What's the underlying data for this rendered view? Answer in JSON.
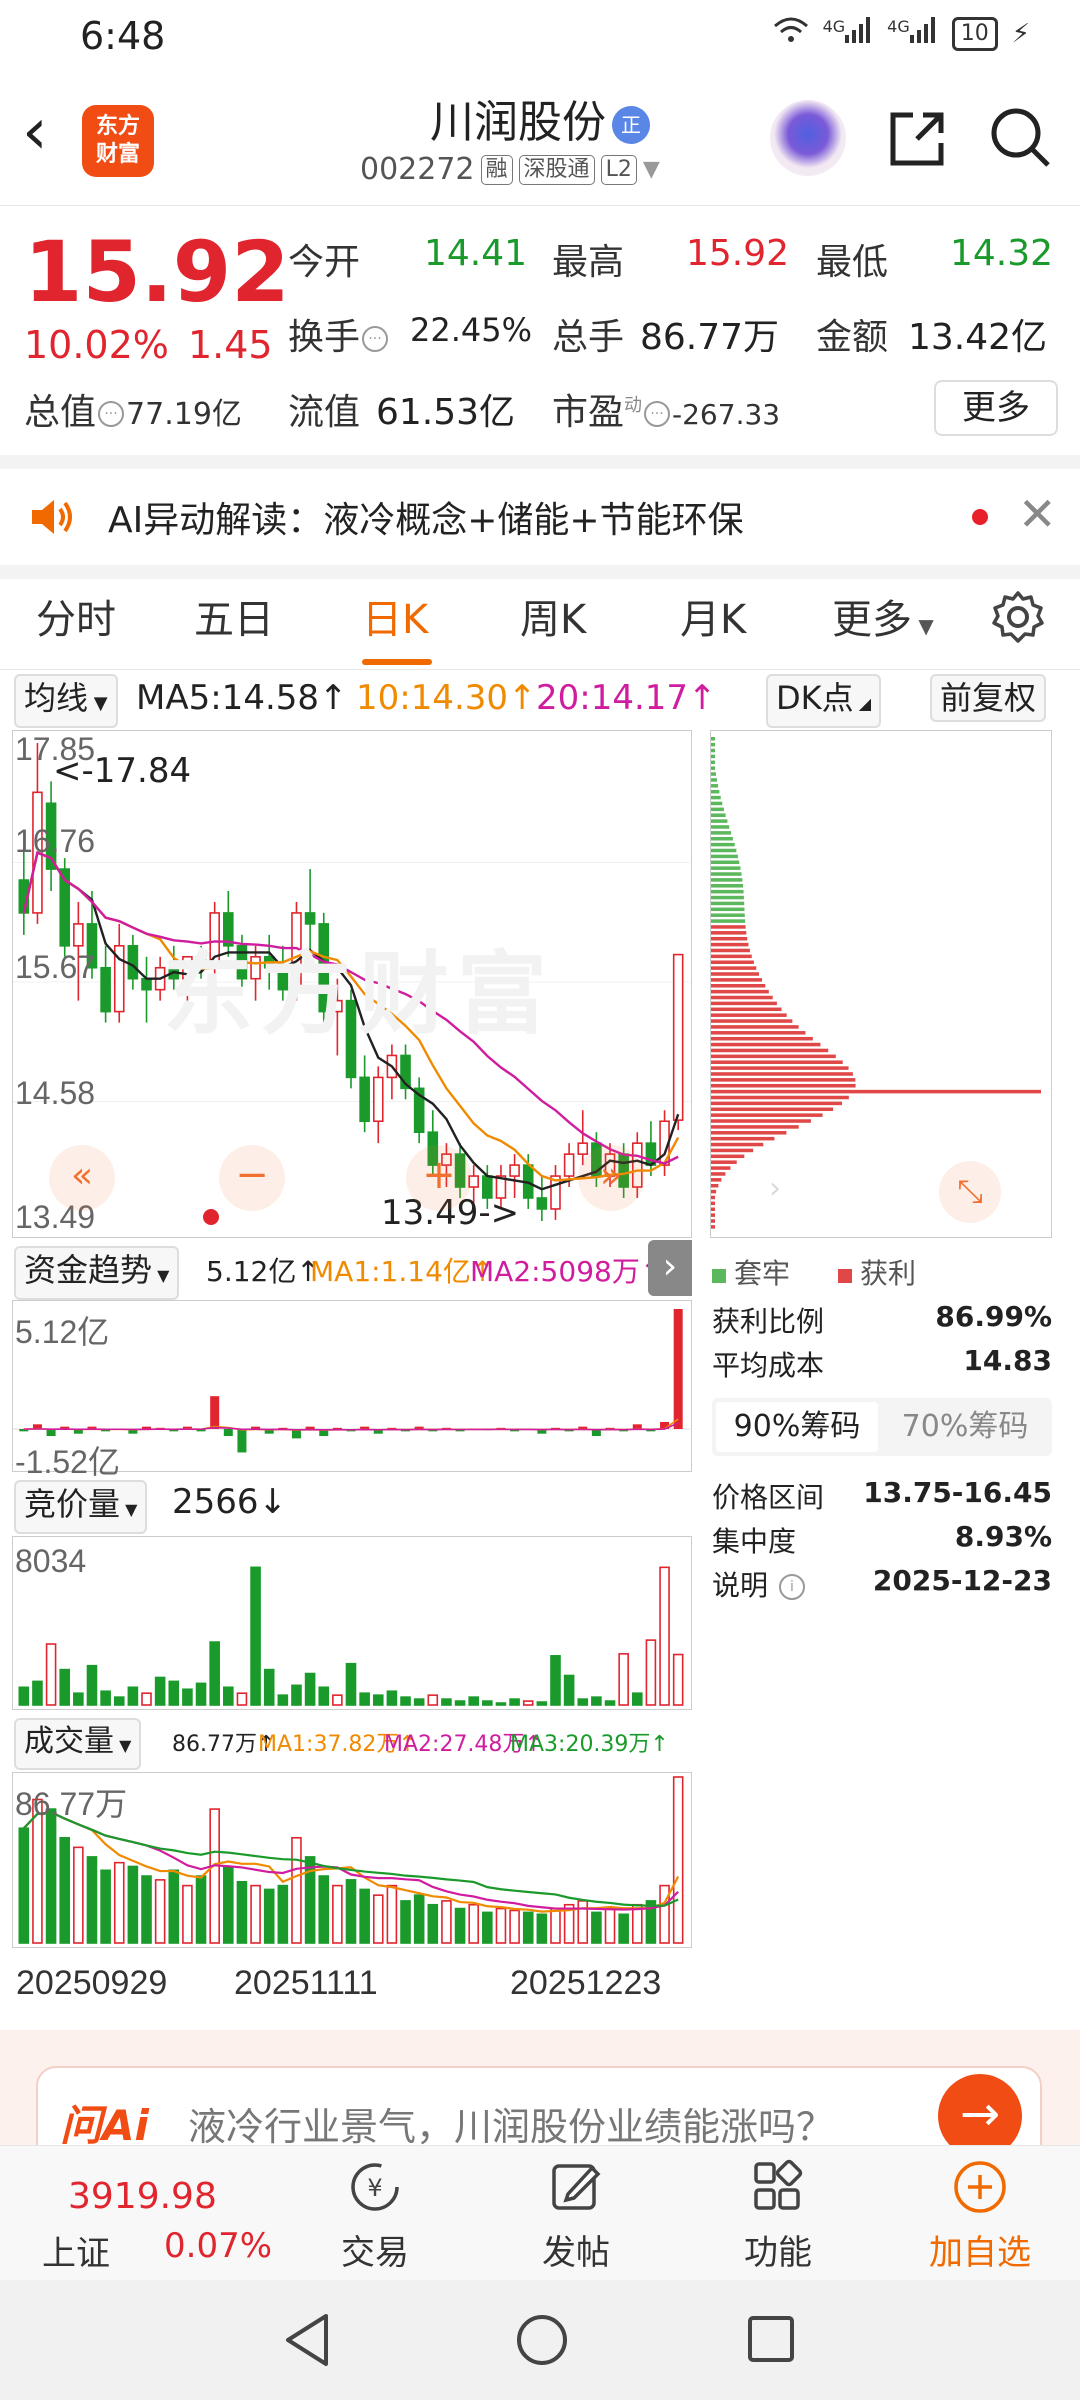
{
  "status": {
    "time": "6:48",
    "net1": "4G",
    "net2": "4G",
    "battery": "10"
  },
  "header": {
    "stock_name": "川润股份",
    "badge": "正",
    "code": "002272",
    "tags": [
      "融",
      "深股通",
      "L2"
    ],
    "logo_line1": "东方",
    "logo_line2": "财富"
  },
  "quote": {
    "price": "15.92",
    "change_pct": "10.02%",
    "change_abs": "1.45",
    "open_label": "今开",
    "open": "14.41",
    "high_label": "最高",
    "high": "15.92",
    "low_label": "最低",
    "low": "14.32",
    "turnover_label": "换手",
    "turnover": "22.45%",
    "volume_label": "总手",
    "volume": "86.77万",
    "amount_label": "金额",
    "amount": "13.42亿",
    "mcap_label": "总值",
    "mcap": "77.19亿",
    "float_label": "流值",
    "float_cap": "61.53亿",
    "pe_label": "市盈",
    "pe_sup": "动",
    "pe": "-267.33",
    "more_label": "更多"
  },
  "ai_bar": {
    "text": "AI异动解读：液冷概念+储能+节能环保"
  },
  "tabs": [
    "分时",
    "五日",
    "日K",
    "周K",
    "月K",
    "更多"
  ],
  "active_tab": 2,
  "ma_row": {
    "selector": "均线",
    "ma5": "MA5:14.58↑",
    "ma10": "10:14.30↑",
    "ma20": "20:14.17↑",
    "dk": "DK点",
    "adjust": "前复权"
  },
  "kline": {
    "y_labels": [
      "17.85",
      "16.76",
      "15.67",
      "14.58",
      "13.49"
    ],
    "max_note": "<-17.84",
    "min_note": "13.49->",
    "watermark": "东方财富"
  },
  "chips": {
    "legend_trapped": "套牢",
    "legend_profit": "获利",
    "rows": [
      {
        "label": "获利比例",
        "value": "86.99%"
      },
      {
        "label": "平均成本",
        "value": "14.83"
      }
    ],
    "tab_90": "90%筹码",
    "tab_70": "70%筹码",
    "rows2": [
      {
        "label": "价格区间",
        "value": "13.75-16.45"
      },
      {
        "label": "集中度",
        "value": "8.93%"
      },
      {
        "label": "说明",
        "value": "2025-12-23"
      }
    ]
  },
  "fund": {
    "selector": "资金趋势",
    "value": "5.12亿↑",
    "ma1": "MA1:1.14亿↑",
    "ma2": "MA2:5098万↑",
    "top_label": "5.12亿",
    "bottom_label": "-1.52亿"
  },
  "auction": {
    "selector": "竞价量",
    "value": "2566↓",
    "top_label": "8034"
  },
  "vol": {
    "selector": "成交量",
    "value": "86.77万↑",
    "ma1": "MA1:37.82万↑",
    "ma2": "MA2:27.48万↑",
    "ma3": "MA3:20.39万↑",
    "top_label": "86.77万"
  },
  "dates": [
    "20250929",
    "20251111",
    "20251223"
  ],
  "question": {
    "ai_label": "问Ai",
    "text": "液冷行业景气，川润股份业绩能涨吗？"
  },
  "bottom_nav": {
    "index_value": "3919.98",
    "index_name": "上证",
    "index_pct": "0.07%",
    "items": [
      "交易",
      "发帖",
      "功能",
      "加自选"
    ]
  },
  "colors": {
    "up": "#e0252e",
    "down": "#1a9a2a",
    "accent": "#f06a00",
    "ma10": "#f08a00",
    "ma20": "#d01c9e"
  },
  "chart_data": {
    "type": "candlestick",
    "title": "",
    "ylim": [
      13.49,
      17.85
    ],
    "x_labels": [
      "20250929",
      "20251111",
      "20251223"
    ],
    "ohlc": [
      [
        16.6,
        16.9,
        16.1,
        16.3
      ],
      [
        16.3,
        17.85,
        16.2,
        17.4
      ],
      [
        17.3,
        17.5,
        16.5,
        16.7
      ],
      [
        16.7,
        16.8,
        15.9,
        16.0
      ],
      [
        16.0,
        16.4,
        15.5,
        16.2
      ],
      [
        16.2,
        16.5,
        15.7,
        15.8
      ],
      [
        15.8,
        16.0,
        15.3,
        15.4
      ],
      [
        15.4,
        16.2,
        15.3,
        16.0
      ],
      [
        16.0,
        16.1,
        15.6,
        15.7
      ],
      [
        15.7,
        15.9,
        15.3,
        15.6
      ],
      [
        15.6,
        15.9,
        15.5,
        15.8
      ],
      [
        15.8,
        16.0,
        15.6,
        15.7
      ],
      [
        15.7,
        15.9,
        15.5,
        15.9
      ],
      [
        15.9,
        16.0,
        15.7,
        15.8
      ],
      [
        15.8,
        16.4,
        15.7,
        16.3
      ],
      [
        16.3,
        16.5,
        15.9,
        16.0
      ],
      [
        16.0,
        16.1,
        15.6,
        15.7
      ],
      [
        15.7,
        16.0,
        15.5,
        15.9
      ],
      [
        15.9,
        16.1,
        15.6,
        15.8
      ],
      [
        15.8,
        16.0,
        15.5,
        15.6
      ],
      [
        15.6,
        16.4,
        15.5,
        16.3
      ],
      [
        16.3,
        16.7,
        15.9,
        16.2
      ],
      [
        16.2,
        16.3,
        15.3,
        15.4
      ],
      [
        15.4,
        15.7,
        15.0,
        15.5
      ],
      [
        15.5,
        15.6,
        14.7,
        14.8
      ],
      [
        14.8,
        15.0,
        14.3,
        14.4
      ],
      [
        14.4,
        14.9,
        14.2,
        14.8
      ],
      [
        14.8,
        15.1,
        14.6,
        15.0
      ],
      [
        15.0,
        15.1,
        14.6,
        14.7
      ],
      [
        14.7,
        14.8,
        14.2,
        14.3
      ],
      [
        14.3,
        14.5,
        13.9,
        14.0
      ],
      [
        14.0,
        14.2,
        13.8,
        14.1
      ],
      [
        14.1,
        14.2,
        13.7,
        13.8
      ],
      [
        13.8,
        14.0,
        13.6,
        13.9
      ],
      [
        13.9,
        14.0,
        13.6,
        13.7
      ],
      [
        13.7,
        14.0,
        13.6,
        13.9
      ],
      [
        13.9,
        14.1,
        13.7,
        14.0
      ],
      [
        14.0,
        14.1,
        13.6,
        13.7
      ],
      [
        13.7,
        13.9,
        13.49,
        13.6
      ],
      [
        13.6,
        14.0,
        13.5,
        13.9
      ],
      [
        13.9,
        14.2,
        13.8,
        14.1
      ],
      [
        14.1,
        14.5,
        14.0,
        14.2
      ],
      [
        14.2,
        14.3,
        13.8,
        13.9
      ],
      [
        13.9,
        14.2,
        13.8,
        14.1
      ],
      [
        14.1,
        14.2,
        13.7,
        13.8
      ],
      [
        13.8,
        14.3,
        13.7,
        14.2
      ],
      [
        14.2,
        14.4,
        13.9,
        14.0
      ],
      [
        14.0,
        14.5,
        13.9,
        14.4
      ],
      [
        14.41,
        15.92,
        14.32,
        15.92
      ]
    ],
    "ma5_last": 14.58,
    "ma10_last": 14.3,
    "ma20_last": 14.17,
    "volume_wan": [
      60,
      75,
      70,
      55,
      50,
      45,
      38,
      42,
      40,
      35,
      33,
      38,
      30,
      35,
      70,
      40,
      32,
      30,
      28,
      30,
      55,
      45,
      35,
      30,
      33,
      28,
      25,
      30,
      22,
      25,
      20,
      22,
      18,
      20,
      16,
      18,
      17,
      16,
      15,
      18,
      20,
      22,
      16,
      18,
      15,
      20,
      22,
      30,
      86.77
    ],
    "fund_yi": [
      -0.1,
      0.2,
      -0.3,
      0.1,
      -0.2,
      0.1,
      -0.1,
      0.0,
      -0.2,
      0.1,
      0.05,
      -0.1,
      0.1,
      -0.1,
      1.4,
      -0.3,
      -1.0,
      0.1,
      -0.2,
      0.05,
      -0.4,
      0.1,
      -0.3,
      0.05,
      -0.1,
      0.1,
      -0.2,
      0.05,
      -0.1,
      0.1,
      -0.1,
      0.05,
      -0.1,
      0.0,
      -0.05,
      0.05,
      -0.1,
      0.0,
      -0.2,
      0.05,
      -0.1,
      0.1,
      -0.3,
      0.05,
      -0.1,
      0.2,
      -0.1,
      0.3,
      5.12
    ],
    "auction": [
      900,
      1200,
      3100,
      1800,
      600,
      2000,
      700,
      400,
      900,
      600,
      1400,
      1200,
      800,
      1100,
      3200,
      900,
      600,
      7000,
      1800,
      500,
      1000,
      1600,
      900,
      500,
      2100,
      600,
      500,
      700,
      400,
      300,
      500,
      300,
      200,
      400,
      200,
      100,
      300,
      200,
      150,
      2500,
      1500,
      300,
      400,
      200,
      2600,
      600,
      3300,
      7000,
      2566
    ],
    "chips_profit_ratio": 86.99,
    "chips_avg_cost": 14.83
  }
}
